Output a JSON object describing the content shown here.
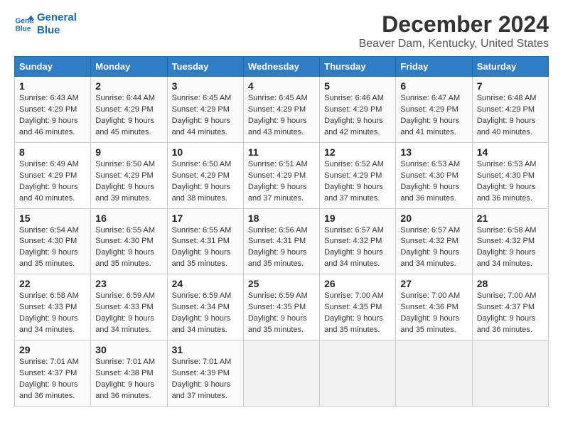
{
  "header": {
    "logo_line1": "General",
    "logo_line2": "Blue",
    "title": "December 2024",
    "subtitle": "Beaver Dam, Kentucky, United States"
  },
  "days_of_week": [
    "Sunday",
    "Monday",
    "Tuesday",
    "Wednesday",
    "Thursday",
    "Friday",
    "Saturday"
  ],
  "weeks": [
    [
      {
        "day": "1",
        "sunrise": "6:43 AM",
        "sunset": "4:29 PM",
        "daylight": "9 hours and 46 minutes."
      },
      {
        "day": "2",
        "sunrise": "6:44 AM",
        "sunset": "4:29 PM",
        "daylight": "9 hours and 45 minutes."
      },
      {
        "day": "3",
        "sunrise": "6:45 AM",
        "sunset": "4:29 PM",
        "daylight": "9 hours and 44 minutes."
      },
      {
        "day": "4",
        "sunrise": "6:45 AM",
        "sunset": "4:29 PM",
        "daylight": "9 hours and 43 minutes."
      },
      {
        "day": "5",
        "sunrise": "6:46 AM",
        "sunset": "4:29 PM",
        "daylight": "9 hours and 42 minutes."
      },
      {
        "day": "6",
        "sunrise": "6:47 AM",
        "sunset": "4:29 PM",
        "daylight": "9 hours and 41 minutes."
      },
      {
        "day": "7",
        "sunrise": "6:48 AM",
        "sunset": "4:29 PM",
        "daylight": "9 hours and 40 minutes."
      }
    ],
    [
      {
        "day": "8",
        "sunrise": "6:49 AM",
        "sunset": "4:29 PM",
        "daylight": "9 hours and 40 minutes."
      },
      {
        "day": "9",
        "sunrise": "6:50 AM",
        "sunset": "4:29 PM",
        "daylight": "9 hours and 39 minutes."
      },
      {
        "day": "10",
        "sunrise": "6:50 AM",
        "sunset": "4:29 PM",
        "daylight": "9 hours and 38 minutes."
      },
      {
        "day": "11",
        "sunrise": "6:51 AM",
        "sunset": "4:29 PM",
        "daylight": "9 hours and 37 minutes."
      },
      {
        "day": "12",
        "sunrise": "6:52 AM",
        "sunset": "4:29 PM",
        "daylight": "9 hours and 37 minutes."
      },
      {
        "day": "13",
        "sunrise": "6:53 AM",
        "sunset": "4:30 PM",
        "daylight": "9 hours and 36 minutes."
      },
      {
        "day": "14",
        "sunrise": "6:53 AM",
        "sunset": "4:30 PM",
        "daylight": "9 hours and 36 minutes."
      }
    ],
    [
      {
        "day": "15",
        "sunrise": "6:54 AM",
        "sunset": "4:30 PM",
        "daylight": "9 hours and 35 minutes."
      },
      {
        "day": "16",
        "sunrise": "6:55 AM",
        "sunset": "4:30 PM",
        "daylight": "9 hours and 35 minutes."
      },
      {
        "day": "17",
        "sunrise": "6:55 AM",
        "sunset": "4:31 PM",
        "daylight": "9 hours and 35 minutes."
      },
      {
        "day": "18",
        "sunrise": "6:56 AM",
        "sunset": "4:31 PM",
        "daylight": "9 hours and 35 minutes."
      },
      {
        "day": "19",
        "sunrise": "6:57 AM",
        "sunset": "4:32 PM",
        "daylight": "9 hours and 34 minutes."
      },
      {
        "day": "20",
        "sunrise": "6:57 AM",
        "sunset": "4:32 PM",
        "daylight": "9 hours and 34 minutes."
      },
      {
        "day": "21",
        "sunrise": "6:58 AM",
        "sunset": "4:32 PM",
        "daylight": "9 hours and 34 minutes."
      }
    ],
    [
      {
        "day": "22",
        "sunrise": "6:58 AM",
        "sunset": "4:33 PM",
        "daylight": "9 hours and 34 minutes."
      },
      {
        "day": "23",
        "sunrise": "6:59 AM",
        "sunset": "4:33 PM",
        "daylight": "9 hours and 34 minutes."
      },
      {
        "day": "24",
        "sunrise": "6:59 AM",
        "sunset": "4:34 PM",
        "daylight": "9 hours and 34 minutes."
      },
      {
        "day": "25",
        "sunrise": "6:59 AM",
        "sunset": "4:35 PM",
        "daylight": "9 hours and 35 minutes."
      },
      {
        "day": "26",
        "sunrise": "7:00 AM",
        "sunset": "4:35 PM",
        "daylight": "9 hours and 35 minutes."
      },
      {
        "day": "27",
        "sunrise": "7:00 AM",
        "sunset": "4:36 PM",
        "daylight": "9 hours and 35 minutes."
      },
      {
        "day": "28",
        "sunrise": "7:00 AM",
        "sunset": "4:37 PM",
        "daylight": "9 hours and 36 minutes."
      }
    ],
    [
      {
        "day": "29",
        "sunrise": "7:01 AM",
        "sunset": "4:37 PM",
        "daylight": "9 hours and 36 minutes."
      },
      {
        "day": "30",
        "sunrise": "7:01 AM",
        "sunset": "4:38 PM",
        "daylight": "9 hours and 36 minutes."
      },
      {
        "day": "31",
        "sunrise": "7:01 AM",
        "sunset": "4:39 PM",
        "daylight": "9 hours and 37 minutes."
      },
      null,
      null,
      null,
      null
    ]
  ],
  "labels": {
    "sunrise": "Sunrise:",
    "sunset": "Sunset:",
    "daylight": "Daylight:"
  }
}
